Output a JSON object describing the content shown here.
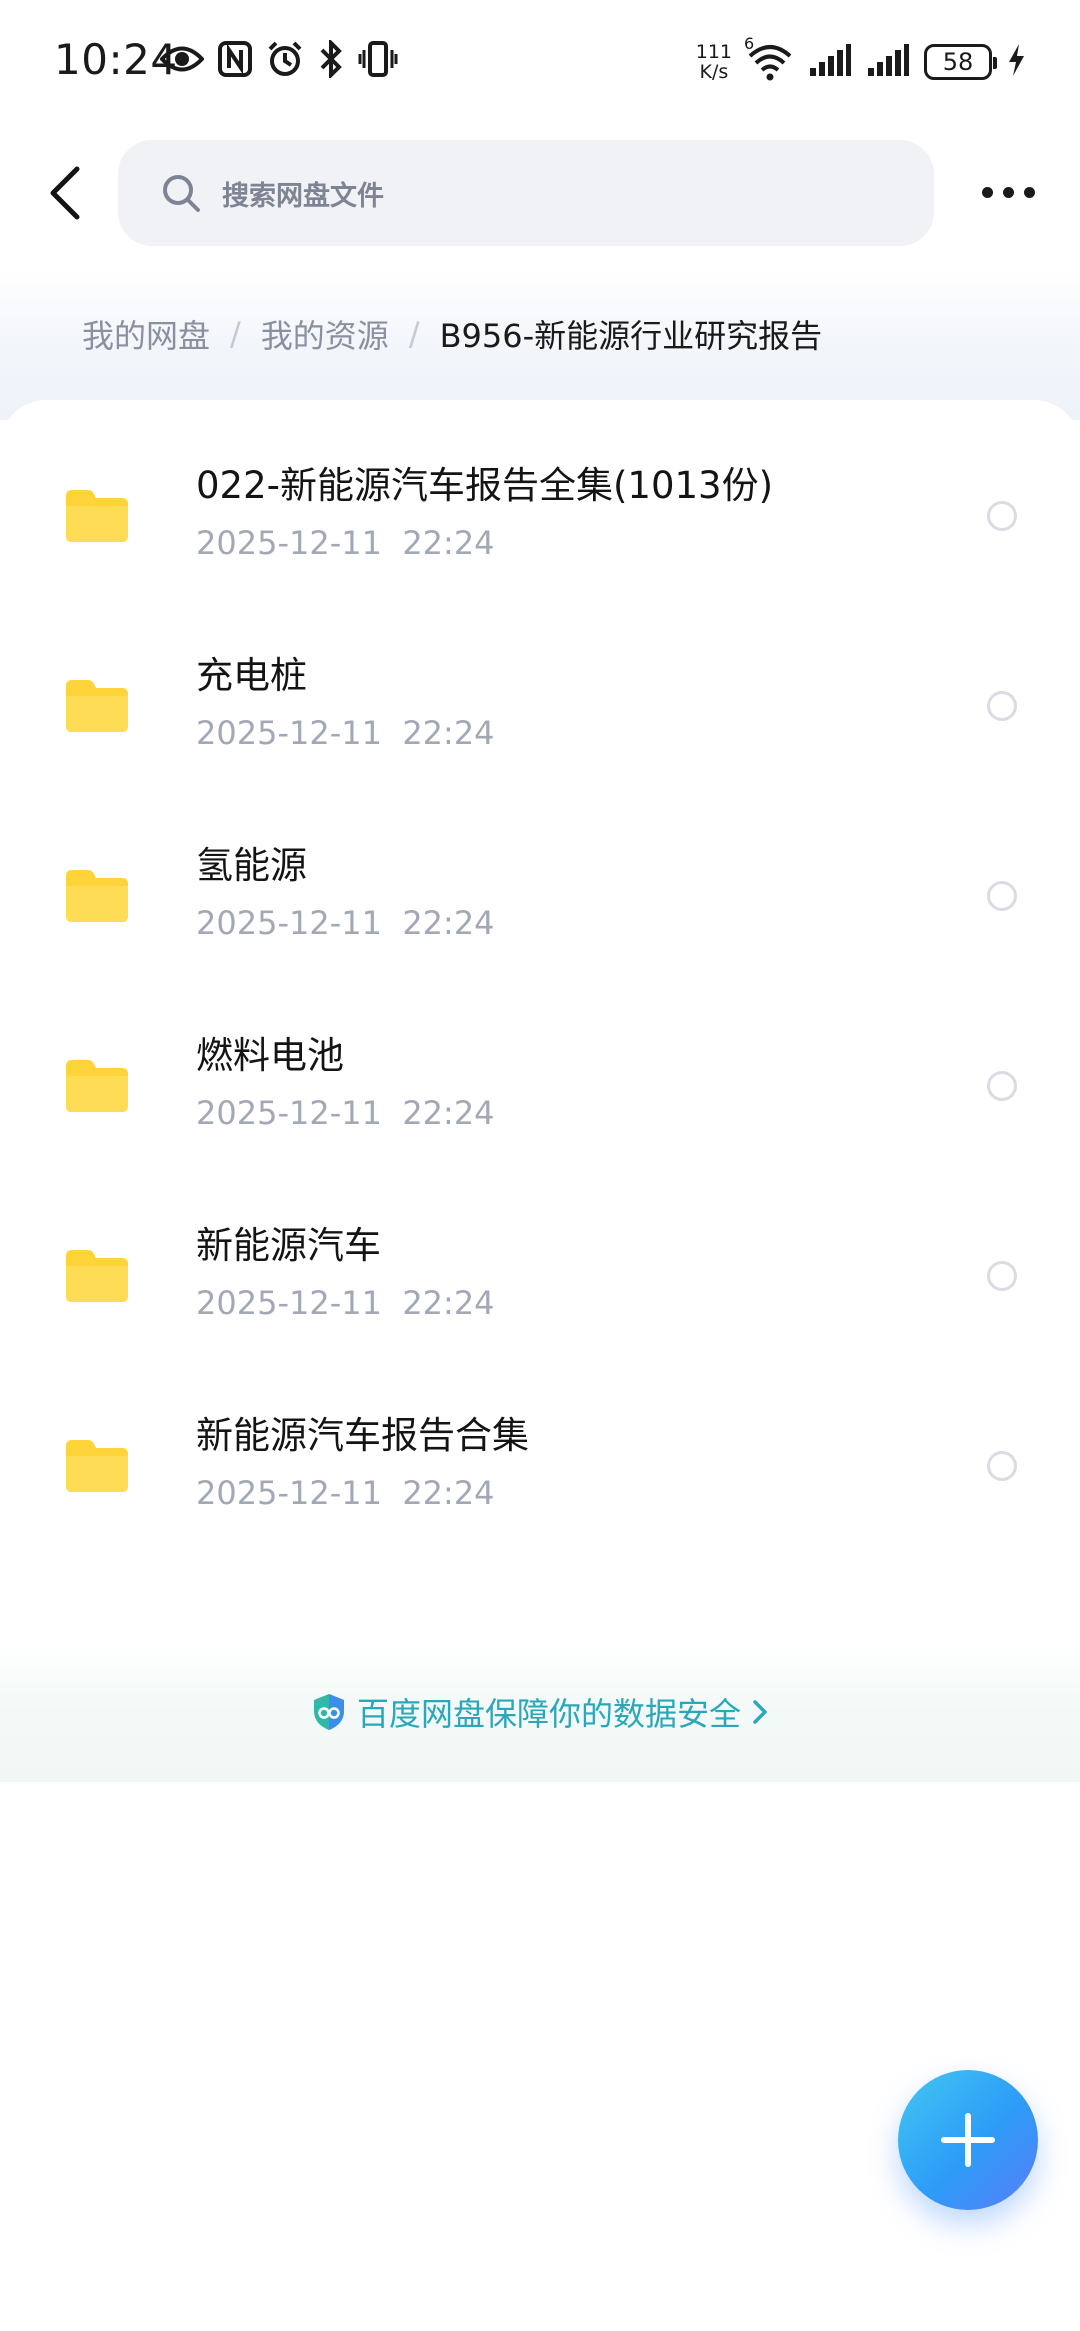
{
  "status_bar": {
    "time": "10:24",
    "net_speed_value": "111",
    "net_speed_unit": "K/s",
    "wifi_badge": "6",
    "battery": "58",
    "icons": [
      "eye-icon",
      "nfc-icon",
      "alarm-icon",
      "bluetooth-icon",
      "vibrate-icon",
      "wifi-icon",
      "signal-icon",
      "signal-icon",
      "battery-icon",
      "charging-icon"
    ]
  },
  "header": {
    "search_placeholder": "搜索网盘文件"
  },
  "breadcrumb": {
    "items": [
      "我的网盘",
      "我的资源",
      "B956-新能源行业研究报告"
    ],
    "separator": "/"
  },
  "files": [
    {
      "name": "022-新能源汽车报告全集(1013份)",
      "date": "2025-12-11  22:24"
    },
    {
      "name": "充电桩",
      "date": "2025-12-11  22:24"
    },
    {
      "name": "氢能源",
      "date": "2025-12-11  22:24"
    },
    {
      "name": "燃料电池",
      "date": "2025-12-11  22:24"
    },
    {
      "name": "新能源汽车",
      "date": "2025-12-11  22:24"
    },
    {
      "name": "新能源汽车报告合集",
      "date": "2025-12-11  22:24"
    }
  ],
  "security_banner": {
    "text": "百度网盘保障你的数据安全"
  },
  "colors": {
    "folder": "#FFD43B",
    "accent": "#2aa8b8",
    "fab_gradient": [
      "#43c7f3",
      "#5a7cf8"
    ]
  }
}
